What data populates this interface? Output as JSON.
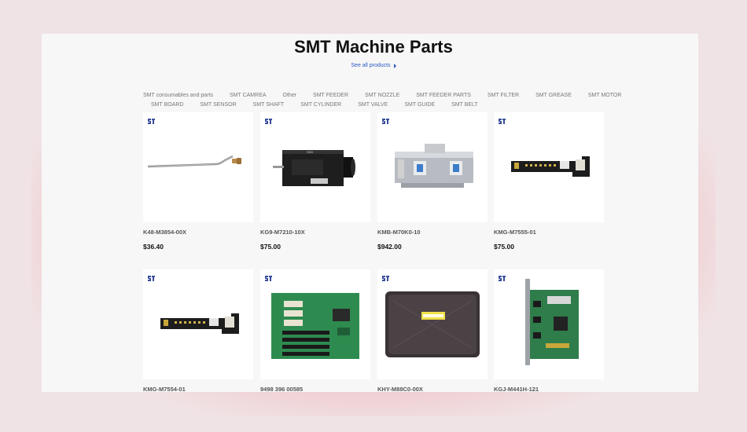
{
  "title": "SMT Machine Parts",
  "see_all": "See all products",
  "categories_row1": [
    "SMT consumables and parts",
    "SMT CAMREA",
    "Other",
    "SMT FEEDER",
    "SMT NOZZLE",
    "SMT FEEDER PARTS",
    "SMT FILTER",
    "SMT GREASE",
    "SMT MOTOR"
  ],
  "categories_row2": [
    "SMT BOARD",
    "SMT SENSOR",
    "SMT SHAFT",
    "SMT CYLINDER",
    "SMT VALVE",
    "SMT GUIDE",
    "SMT BELT"
  ],
  "products": [
    {
      "name": "K48-M3854-00X",
      "price": "$36.40",
      "icon": "steel-tube-part"
    },
    {
      "name": "KG9-M7210-10X",
      "price": "$75.00",
      "icon": "camera-module"
    },
    {
      "name": "KMB-M70K0-10",
      "price": "$942.00",
      "icon": "feeder-unit"
    },
    {
      "name": "KMG-M7555-01",
      "price": "$75.00",
      "icon": "pcb-board"
    },
    {
      "name": "KMG-M7554-01",
      "price": "",
      "icon": "pcb-board"
    },
    {
      "name": "9498 396 00585",
      "price": "",
      "icon": "backplane-board"
    },
    {
      "name": "KHY-M88C0-00X",
      "price": "",
      "icon": "packaged-part"
    },
    {
      "name": "KGJ-M441H-121",
      "price": "",
      "icon": "pci-card"
    }
  ],
  "colors": {
    "background": "#f0e3e5",
    "panel": "#f7f7f7",
    "link": "#2b59c3",
    "badge": "#3a4e9c"
  }
}
